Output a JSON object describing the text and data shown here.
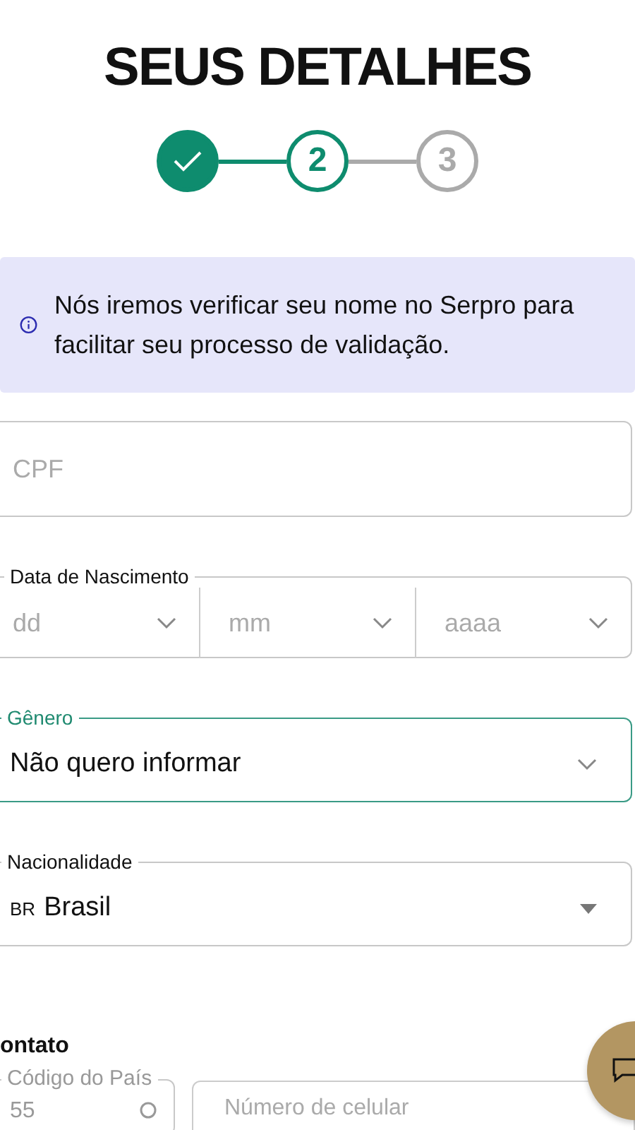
{
  "title": "SEUS DETALHES",
  "stepper": {
    "steps": [
      {
        "completed": true,
        "selected": false
      },
      {
        "label": "2",
        "completed": false,
        "selected": true
      },
      {
        "label": "3",
        "completed": false,
        "selected": false
      }
    ]
  },
  "notice": {
    "text": "Nós iremos verificar seu nome no Serpro para facilitar seu processo de validação."
  },
  "fields": [
    {
      "kind": "text",
      "placeholder": "CPF"
    },
    {
      "kind": "date",
      "label": "Data de Nascimento",
      "parts": [
        {
          "placeholder": "dd"
        },
        {
          "placeholder": "mm"
        },
        {
          "placeholder": "aaaa"
        }
      ]
    },
    {
      "kind": "select",
      "label": "Gênero",
      "value": "Não quero informar",
      "focused": true
    },
    {
      "kind": "country",
      "label": "Nacionalidade",
      "prefix": "BR",
      "value": "Brasil",
      "focused": false
    }
  ],
  "contact": {
    "heading": "ontato",
    "code_label": "Código do País",
    "code_value": "55",
    "phone_placeholder": "Número de celular"
  }
}
